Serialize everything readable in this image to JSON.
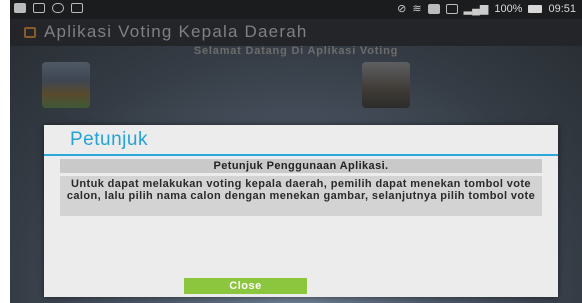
{
  "status_bar": {
    "icons_left": [
      "message-icon",
      "gallery-icon",
      "voicemail-icon",
      "chat-icon"
    ],
    "icons_right": [
      "no-sim-icon",
      "wifi-icon",
      "notification-icon",
      "lte-icon",
      "signal-icon"
    ],
    "battery": "100%",
    "time": "09:51"
  },
  "app_bar": {
    "title": "Aplikasi Voting Kepala Daerah",
    "icon": "app-icon"
  },
  "main": {
    "welcome": "Selamat Datang Di Aplikasi Voting"
  },
  "dialog": {
    "title": "Petunjuk",
    "header": "Petunjuk Penggunaan Aplikasi.",
    "body": "Untuk dapat melakukan voting kepala daerah, pemilih dapat menekan tombol vote calon, lalu pilih nama calon dengan menekan gambar, selanjutnya pilih tombol vote",
    "close_label": "Close"
  },
  "colors": {
    "accent": "#23a3d6",
    "close_button": "#8cc63f",
    "dialog_background": "#ececec"
  }
}
